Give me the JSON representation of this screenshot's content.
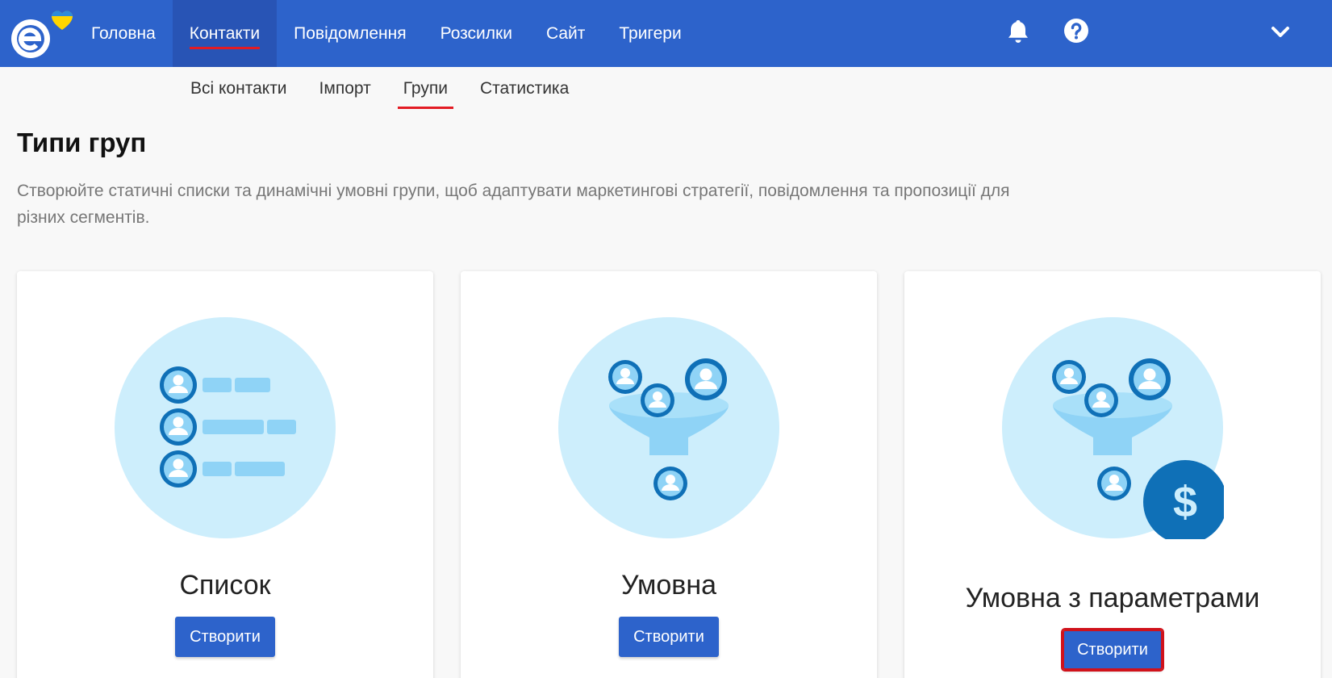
{
  "nav": {
    "items": [
      {
        "label": "Головна"
      },
      {
        "label": "Контакти",
        "active": true
      },
      {
        "label": "Повідомлення"
      },
      {
        "label": "Розсилки"
      },
      {
        "label": "Сайт"
      },
      {
        "label": "Тригери"
      }
    ],
    "icons": [
      "bell-icon",
      "help-icon",
      "chevron-down-icon"
    ]
  },
  "subnav": {
    "items": [
      {
        "label": "Всі контакти"
      },
      {
        "label": "Імпорт"
      },
      {
        "label": "Групи",
        "active": true
      },
      {
        "label": "Статистика"
      }
    ]
  },
  "page": {
    "title": "Типи груп",
    "description": "Створюйте статичні списки та динамічні умовні групи, щоб адаптувати маркетингові стратегії, повідомлення та пропозиції для різних сегментів."
  },
  "cards": [
    {
      "title": "Список",
      "button": "Створити",
      "icon": "contact-list-icon"
    },
    {
      "title": "Умовна",
      "button": "Створити",
      "icon": "contact-funnel-icon"
    },
    {
      "title": "Умовна з параметрами",
      "button": "Створити",
      "icon": "funnel-dollar-icon",
      "highlighted": true
    }
  ],
  "colors": {
    "brand": "#2d63cb",
    "accent_underline": "#e31b23",
    "illustration_bg": "#cdeefc",
    "illustration_dark": "#0f70b7",
    "illustration_light": "#8fd3f6"
  }
}
